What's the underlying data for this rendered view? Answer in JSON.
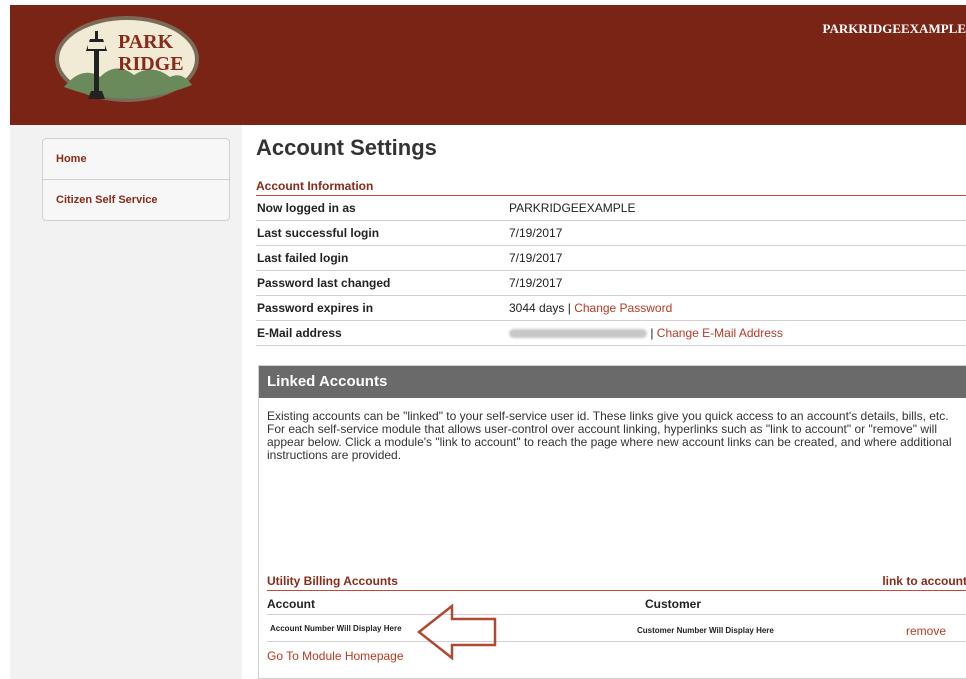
{
  "header": {
    "logo_line1": "PARK",
    "logo_line2": "RIDGE",
    "username": "PARKRIDGEEXAMPLE"
  },
  "nav": {
    "items": [
      {
        "label": "Home"
      },
      {
        "label": "Citizen Self Service"
      }
    ]
  },
  "page_title": "Account Settings",
  "account_info": {
    "title": "Account Information",
    "rows": [
      {
        "label": "Now logged in as",
        "value": "PARKRIDGEEXAMPLE"
      },
      {
        "label": "Last successful login",
        "value": "7/19/2017"
      },
      {
        "label": "Last failed login",
        "value": "7/19/2017"
      },
      {
        "label": "Password last changed",
        "value": "7/19/2017"
      },
      {
        "label": "Password expires in",
        "value": "3044 days",
        "separator": " | ",
        "link": "Change Password"
      },
      {
        "label": "E-Mail address",
        "separator": " | ",
        "link": "Change E-Mail Address"
      }
    ]
  },
  "linked": {
    "title": "Linked Accounts",
    "description": "Existing accounts can be \"linked\" to your self-service user id. These links give you quick access to an account's details, bills, etc. For each self-service module that allows user-control over account linking, hyperlinks such as \"link to account\" or \"remove\" will appear below. Click a module's \"link to account\" to reach the page where new account links can be created, and where additional instructions are provided.",
    "utility": {
      "title": "Utility Billing Accounts",
      "link_label": "link to account",
      "col_account": "Account",
      "col_customer": "Customer",
      "account_value": "Account Number Will Display Here",
      "customer_value": "Customer Number Will Display Here",
      "remove_label": "remove",
      "goto_label": "Go To Module Homepage"
    }
  },
  "colors": {
    "header_bg": "#7a2416",
    "accent": "#8a2a1a",
    "link": "#b83a24",
    "panel_header_bg": "#6a6a6a"
  }
}
